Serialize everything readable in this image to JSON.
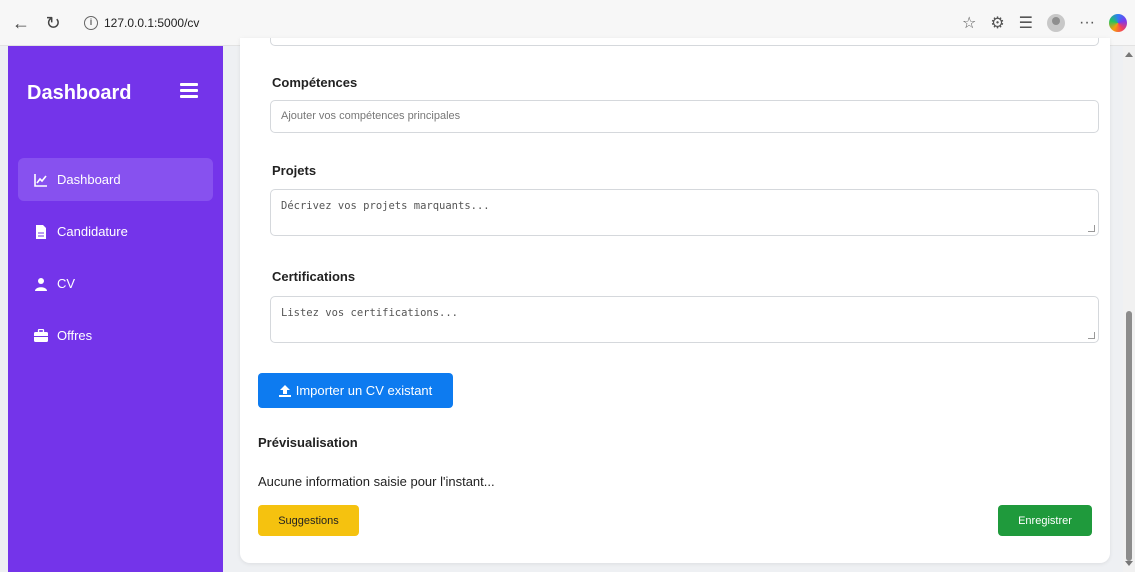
{
  "browser": {
    "url": "127.0.0.1:5000/cv",
    "icons": [
      "back-arrow-icon",
      "reload-icon",
      "info-icon",
      "star-icon",
      "extensions-icon",
      "favorites-icon",
      "profile-icon",
      "more-icon",
      "copilot-icon"
    ],
    "more_label": "···"
  },
  "sidebar": {
    "brand": "Dashboard",
    "accent_color": "#7434ea",
    "items": [
      {
        "label": "Dashboard",
        "icon": "chart-line-icon",
        "active": true
      },
      {
        "label": "Candidature",
        "icon": "file-icon",
        "active": false
      },
      {
        "label": "CV",
        "icon": "user-icon",
        "active": false
      },
      {
        "label": "Offres",
        "icon": "briefcase-icon",
        "active": false
      }
    ]
  },
  "form": {
    "competences": {
      "label": "Compétences",
      "placeholder": "Ajouter vos compétences principales"
    },
    "projets": {
      "label": "Projets",
      "placeholder": "Décrivez vos projets marquants..."
    },
    "certifications": {
      "label": "Certifications",
      "placeholder": "Listez vos certifications..."
    },
    "import_button": "Importer un CV existant",
    "import_color": "#0d7bf0"
  },
  "preview": {
    "title": "Prévisualisation",
    "text": "Aucune information saisie pour l'instant..."
  },
  "actions": {
    "suggestions": "Suggestions",
    "suggestions_color": "#f5c20f",
    "save": "Enregistrer",
    "save_color": "#1f9a3c"
  }
}
